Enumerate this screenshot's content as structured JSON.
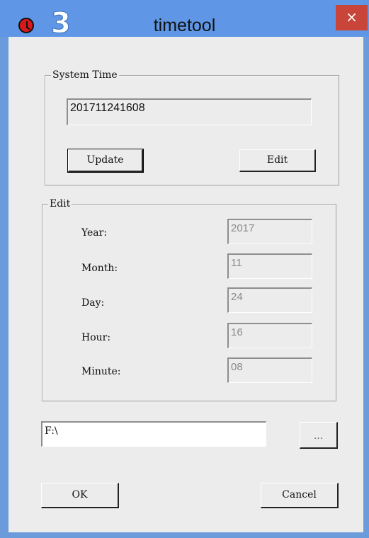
{
  "window": {
    "title": "timetool",
    "close_glyph": "×",
    "annotation_number": "3",
    "colors": {
      "titlebar": "#5f97e6",
      "close": "#c9453a",
      "client": "#ececec"
    }
  },
  "system_time": {
    "legend": "System Time",
    "value": "201711241608",
    "update_label": "Update",
    "edit_label": "Edit"
  },
  "edit": {
    "legend": "Edit",
    "rows": [
      {
        "label": "Year:",
        "value": "2017"
      },
      {
        "label": "Month:",
        "value": "11"
      },
      {
        "label": "Day:",
        "value": "24"
      },
      {
        "label": "Hour:",
        "value": "16"
      },
      {
        "label": "Minute:",
        "value": "08"
      }
    ]
  },
  "path": {
    "value": "F:\\",
    "browse_label": "..."
  },
  "footer": {
    "ok_label": "OK",
    "cancel_label": "Cancel"
  }
}
